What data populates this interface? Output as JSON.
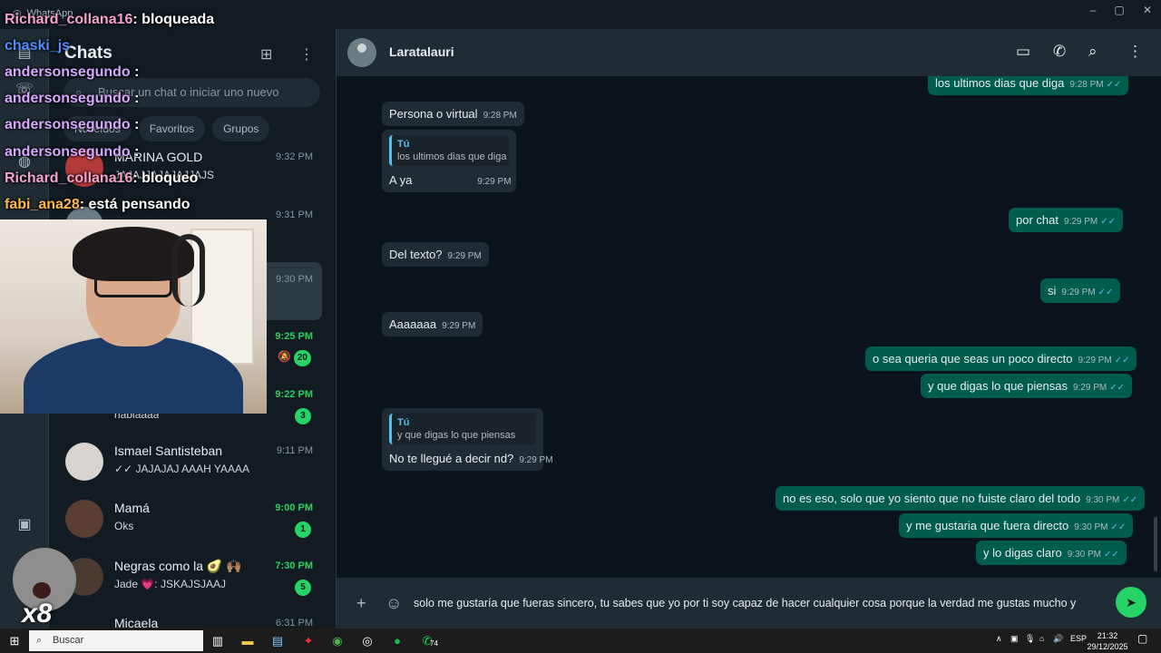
{
  "window": {
    "app_title": "WhatsApp",
    "controls": [
      "–",
      "▢",
      "✕"
    ]
  },
  "overlay_chat": [
    {
      "user": "Richard_collana16",
      "text": ": bloqueada",
      "color": "#f4a3c9"
    },
    {
      "user": "chaski_js",
      "text": "",
      "color": "#4f8cff"
    },
    {
      "user": "andersonsegundo",
      "text": ":",
      "color": "#d6a8ff"
    },
    {
      "user": "andersonsegundo",
      "text": ":",
      "color": "#d6a8ff"
    },
    {
      "user": "andersonsegundo",
      "text": ":",
      "color": "#d6a8ff"
    },
    {
      "user": "andersonsegundo",
      "text": ":",
      "color": "#d6a8ff"
    },
    {
      "user": "Richard_collana16",
      "text": ": bloqueo",
      "color": "#f4a3c9"
    },
    {
      "user": "fabi_ana28",
      "text": ": está pensando",
      "color": "#ffb84d"
    }
  ],
  "sidebar": {
    "title": "Chats",
    "search_placeholder": "Buscar un chat o iniciar uno nuevo",
    "filters": [
      "No leídos",
      "Favoritos",
      "Grupos"
    ],
    "chats": [
      {
        "name": "MARINA GOLD",
        "last": "JAJAJJAJAJAJJAJS",
        "time": "9:32 PM",
        "unread": "",
        "time_green": false
      },
      {
        "name": "",
        "last": "",
        "time": "9:31 PM",
        "unread": "",
        "time_green": false
      },
      {
        "name": "",
        "last": "",
        "time": "9:30 PM",
        "unread": "",
        "time_green": false
      },
      {
        "name": "",
        "last": "",
        "time": "9:25 PM",
        "unread": "20",
        "time_green": true
      },
      {
        "name": "",
        "last": "habiaaaa",
        "time": "9:22 PM",
        "unread": "3",
        "time_green": true
      },
      {
        "name": "Ismael Santisteban",
        "last": "✓✓ JAJAJAJ AAAH YAAAA",
        "time": "9:11 PM",
        "unread": "",
        "time_green": false
      },
      {
        "name": "Mamá",
        "last": "Oks",
        "time": "9:00 PM",
        "unread": "1",
        "time_green": true
      },
      {
        "name": "Negras como la 🥑 🙌🏽",
        "last": "Jade 💗: JSKAJSJAAJ",
        "time": "7:30 PM",
        "unread": "5",
        "time_green": true
      },
      {
        "name": "Micaela",
        "last": "",
        "time": "6:31 PM",
        "unread": "",
        "time_green": false
      }
    ]
  },
  "conversation": {
    "contact_name": "Laratalauri",
    "messages": [
      {
        "dir": "out",
        "text": "los ultimos dias que diga",
        "time": "9:28 PM"
      },
      {
        "dir": "in",
        "text": "Persona o virtual",
        "time": "9:28 PM"
      },
      {
        "dir": "in",
        "quote_author": "Tú",
        "quote_text": "los ultimos dias que diga",
        "text": "A ya",
        "time": "9:29 PM"
      },
      {
        "dir": "out",
        "text": "por chat",
        "time": "9:29 PM"
      },
      {
        "dir": "in",
        "text": "Del texto?",
        "time": "9:29 PM"
      },
      {
        "dir": "out",
        "text": "si",
        "time": "9:29 PM"
      },
      {
        "dir": "in",
        "text": "Aaaaaaa",
        "time": "9:29 PM"
      },
      {
        "dir": "out",
        "text": "o sea queria que seas un poco directo",
        "time": "9:29 PM"
      },
      {
        "dir": "out",
        "text": "y que digas lo que piensas",
        "time": "9:29 PM"
      },
      {
        "dir": "in",
        "quote_author": "Tú",
        "quote_text": "y que digas lo que piensas",
        "text": "No te llegué a decir nd?",
        "time": "9:29 PM"
      },
      {
        "dir": "out",
        "text": "no es eso, solo que yo siento que no fuiste claro del todo",
        "time": "9:30 PM"
      },
      {
        "dir": "out",
        "text": "y me gustaria que fuera directo",
        "time": "9:30 PM"
      },
      {
        "dir": "out",
        "text": "y lo digas claro",
        "time": "9:30 PM"
      }
    ],
    "draft": "solo me gustaría que fueras sincero, tu sabes que yo por ti soy capaz de hacer cualquier cosa porque la verdad me gustas mucho y"
  },
  "sticker_label": "x8",
  "taskbar": {
    "search_label": "Buscar",
    "whatsapp_badge": "74",
    "lang": "ESP",
    "time": "21:32",
    "date": "29/12/2025"
  },
  "colors": {
    "accent_green": "#25d366",
    "outgoing_bubble": "#005c4b",
    "incoming_bubble": "#202c33",
    "read_tick": "#53bdeb"
  }
}
